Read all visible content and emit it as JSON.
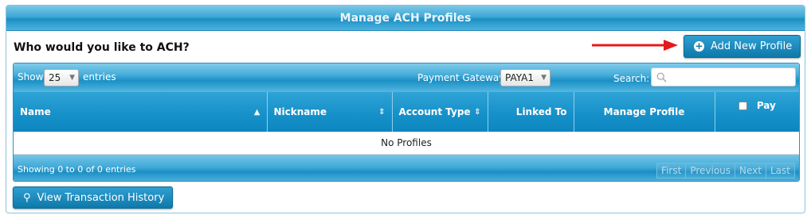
{
  "panel": {
    "title": "Manage ACH Profiles"
  },
  "prompt": {
    "title": "Who would you like to ACH?"
  },
  "buttons": {
    "add_profile": "Add New Profile",
    "view_history": "View Transaction History"
  },
  "toolbar": {
    "show_label": "Show",
    "entries_value": "25",
    "entries_label": "entries",
    "gateway_label": "Payment Gateway:",
    "gateway_value": "PAYA1",
    "search_label": "Search:",
    "search_value": ""
  },
  "table": {
    "columns": [
      "Name",
      "Nickname",
      "Account Type",
      "Linked To",
      "Manage Profile",
      "Pay"
    ],
    "empty_message": "No Profiles"
  },
  "footer": {
    "info": "Showing 0 to 0 of 0 entries",
    "pager": [
      "First",
      "Previous",
      "Next",
      "Last"
    ]
  },
  "colors": {
    "header_blue": "#1b8fc4",
    "button_blue": "#0e79ab",
    "arrow_red": "#e31b1b"
  },
  "icons": {
    "add": "plus-circle-icon",
    "history": "search-icon",
    "sort": "sort-arrows-icon"
  }
}
